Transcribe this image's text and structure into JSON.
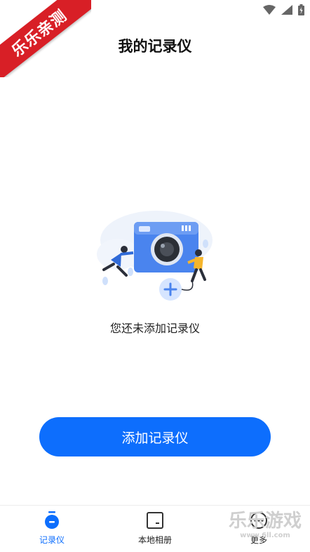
{
  "corner_ribbon": {
    "text": "乐乐亲测"
  },
  "header": {
    "title": "我的记录仪"
  },
  "empty_state": {
    "message": "您还未添加记录仪",
    "illustration": "camera-with-people-illustration"
  },
  "primary_action": {
    "label": "添加记录仪"
  },
  "tabs": [
    {
      "label": "记录仪",
      "icon": "recorder-icon",
      "active": true
    },
    {
      "label": "本地相册",
      "icon": "album-icon",
      "active": false
    },
    {
      "label": "更多",
      "icon": "more-icon",
      "active": false
    }
  ],
  "watermark": {
    "big": "乐乐游戏",
    "small": "www.6ll.com"
  },
  "colors": {
    "accent": "#0d6efd",
    "ribbon": "#d81f26"
  }
}
